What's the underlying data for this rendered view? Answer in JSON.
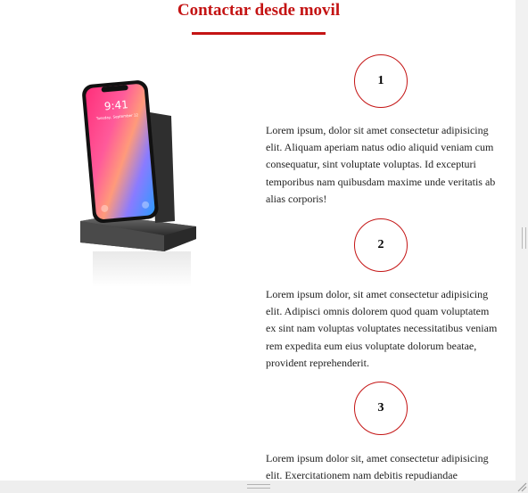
{
  "section": {
    "title": "Contactar desde movil"
  },
  "phone": {
    "time": "9:41",
    "date": "Tuesday, September 12",
    "icon": "smartphone-on-wireless-charger-image"
  },
  "steps": [
    {
      "number": "1",
      "text": "Lorem ipsum, dolor sit amet consectetur adipisicing elit. Aliquam aperiam natus odio aliquid veniam cum consequatur, sint voluptate voluptas. Id excepturi temporibus nam quibusdam maxime unde veritatis ab alias corporis!"
    },
    {
      "number": "2",
      "text": "Lorem ipsum dolor, sit amet consectetur adipisicing elit. Adipisci omnis dolorem quod quam voluptatem ex sint nam voluptas voluptates necessitatibus veniam rem expedita eum eius voluptate dolorum beatae, provident reprehenderit."
    },
    {
      "number": "3",
      "text": "Lorem ipsum dolor sit, amet consectetur adipisicing elit. Exercitationem nam debitis repudiandae"
    }
  ],
  "colors": {
    "accent": "#c41414"
  }
}
